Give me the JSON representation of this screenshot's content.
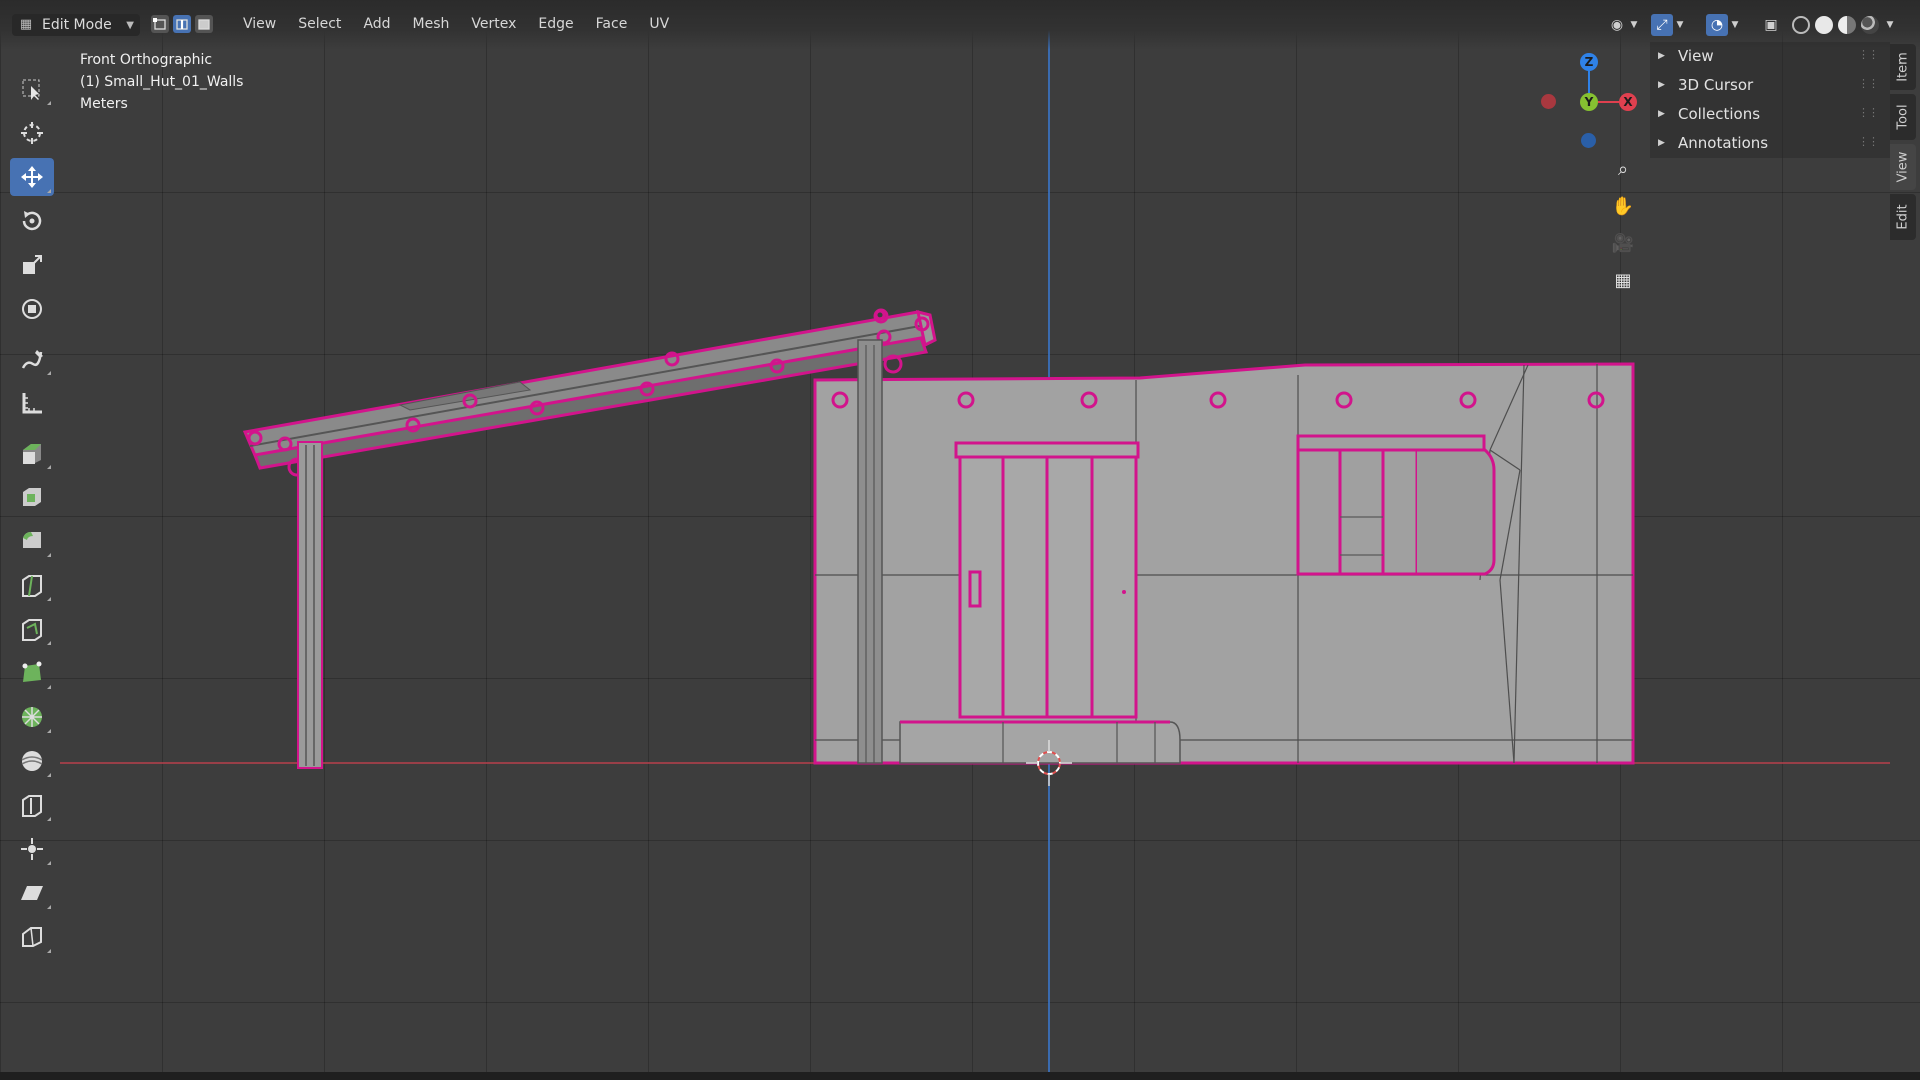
{
  "header": {
    "mode": "Edit Mode",
    "menus": [
      "View",
      "Select",
      "Add",
      "Mesh",
      "Vertex",
      "Edge",
      "Face",
      "UV"
    ],
    "select_modes": [
      "vertex-select-icon",
      "edge-select-icon",
      "face-select-icon"
    ],
    "active_select_mode": "edge",
    "right_icons": [
      "visibility-icon",
      "gizmo-toggle-icon",
      "overlay-icon",
      "xray-icon",
      "wireframe-shading-icon",
      "solid-shading-icon",
      "material-shading-icon",
      "rendered-shading-icon"
    ]
  },
  "overlay": {
    "view_name": "Front Orthographic",
    "object_name": "(1) Small_Hut_01_Walls",
    "units": "Meters"
  },
  "toolbar": {
    "tools": [
      "select-box",
      "cursor",
      "move",
      "rotate",
      "scale",
      "transform",
      "annotate",
      "measure",
      "extrude-region",
      "inset-faces",
      "bevel",
      "loop-cut",
      "knife",
      "poly-build",
      "spin",
      "smooth",
      "edge-slide",
      "shrink-fatten",
      "shear",
      "rip-region"
    ],
    "active_tool": "move"
  },
  "gizmo": {
    "z": "Z",
    "y": "Y",
    "x": "X"
  },
  "nav_buttons": [
    "zoom-icon",
    "pan-hand-icon",
    "camera-icon",
    "grid-toggle-icon"
  ],
  "npanel": {
    "sections": [
      "View",
      "3D Cursor",
      "Collections",
      "Annotations"
    ]
  },
  "sidebar_tabs": [
    "Item",
    "Tool",
    "View",
    "Edit"
  ],
  "active_sidebar_tab": "View",
  "colors": {
    "background": "#3d3d3d",
    "selection": "#d2148c",
    "wall_fill": "#a2a2a2",
    "active_blue": "#4772b3",
    "axis_x": "#e0404f",
    "axis_y": "#86c131",
    "axis_z": "#2f82e8"
  }
}
